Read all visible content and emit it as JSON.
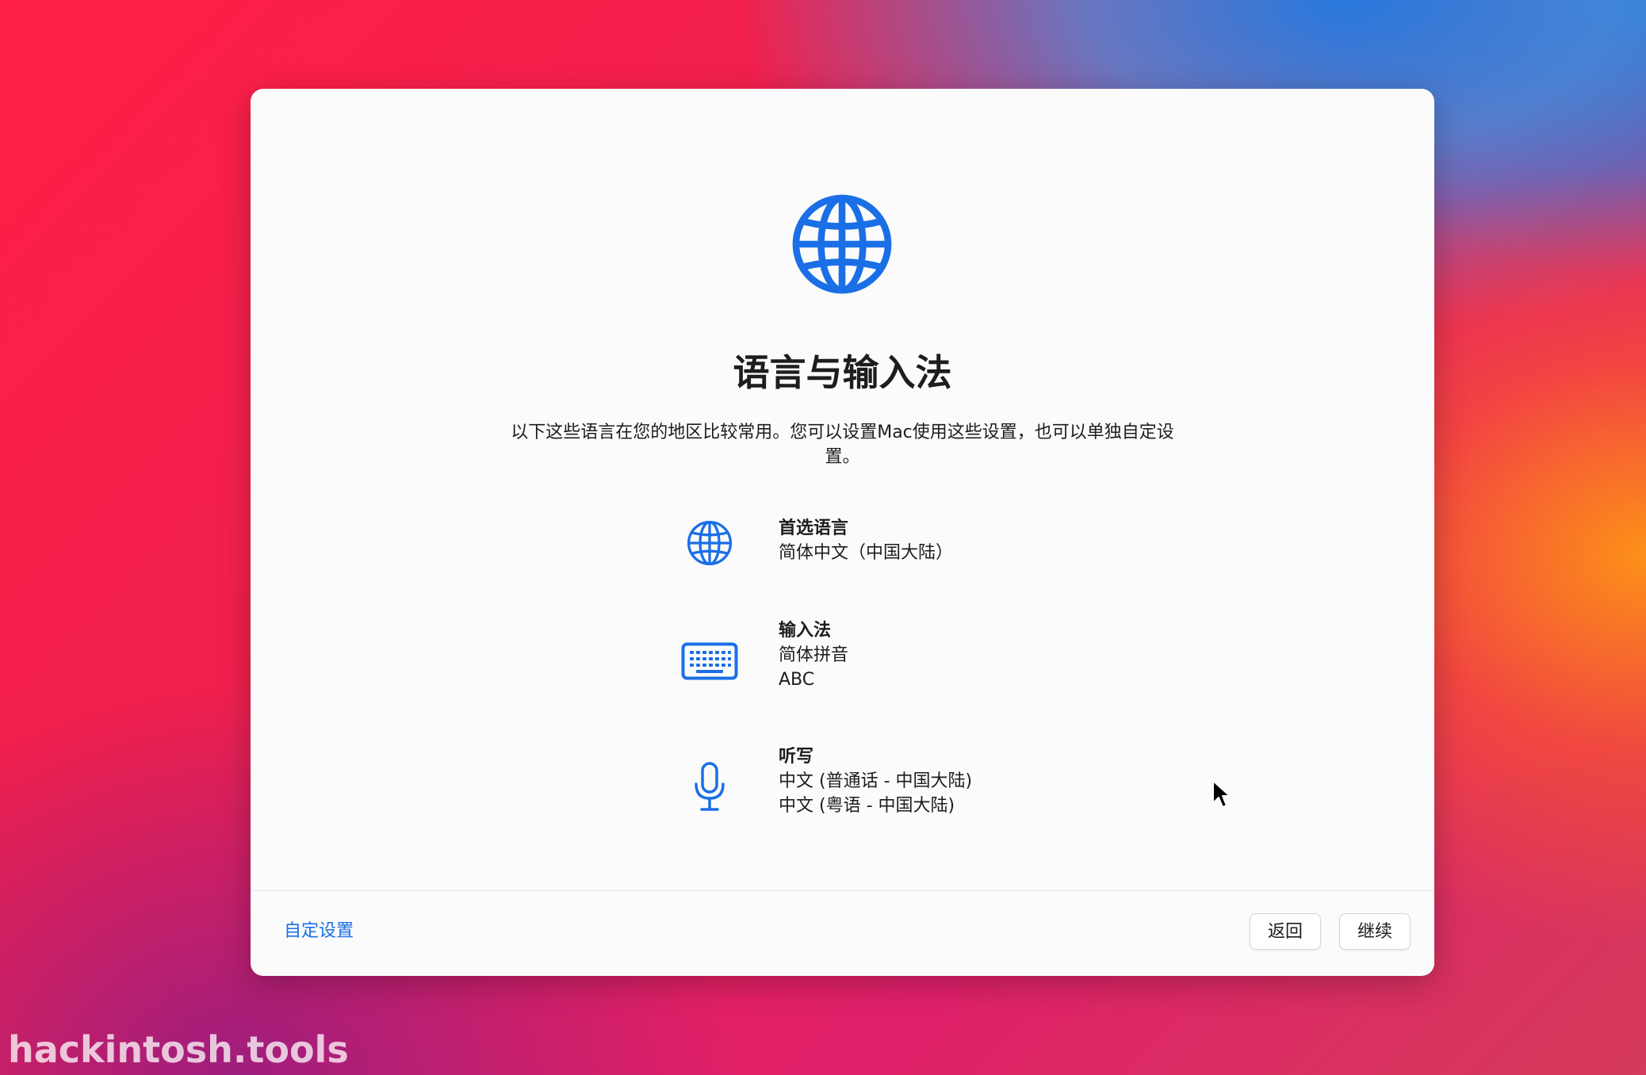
{
  "window": {
    "title": "语言与输入法",
    "description": "以下这些语言在您的地区比较常用。您可以设置Mac使用这些设置，也可以单独自定设置。"
  },
  "settings": {
    "preferred_language": {
      "label": "首选语言",
      "values": [
        "简体中文（中国大陆）"
      ],
      "icon": "globe-icon"
    },
    "input_method": {
      "label": "输入法",
      "values": [
        "简体拼音",
        "ABC"
      ],
      "icon": "keyboard-icon"
    },
    "dictation": {
      "label": "听写",
      "values": [
        "中文 (普通话 - 中国大陆)",
        "中文 (粤语 - 中国大陆)"
      ],
      "icon": "microphone-icon"
    }
  },
  "footer": {
    "customize_label": "自定设置",
    "back_label": "返回",
    "continue_label": "继续"
  },
  "watermark": "hackintosh.tools",
  "colors": {
    "accent": "#1a6fe6",
    "text": "#1d1d1f",
    "window_bg": "#fbfbfb"
  }
}
